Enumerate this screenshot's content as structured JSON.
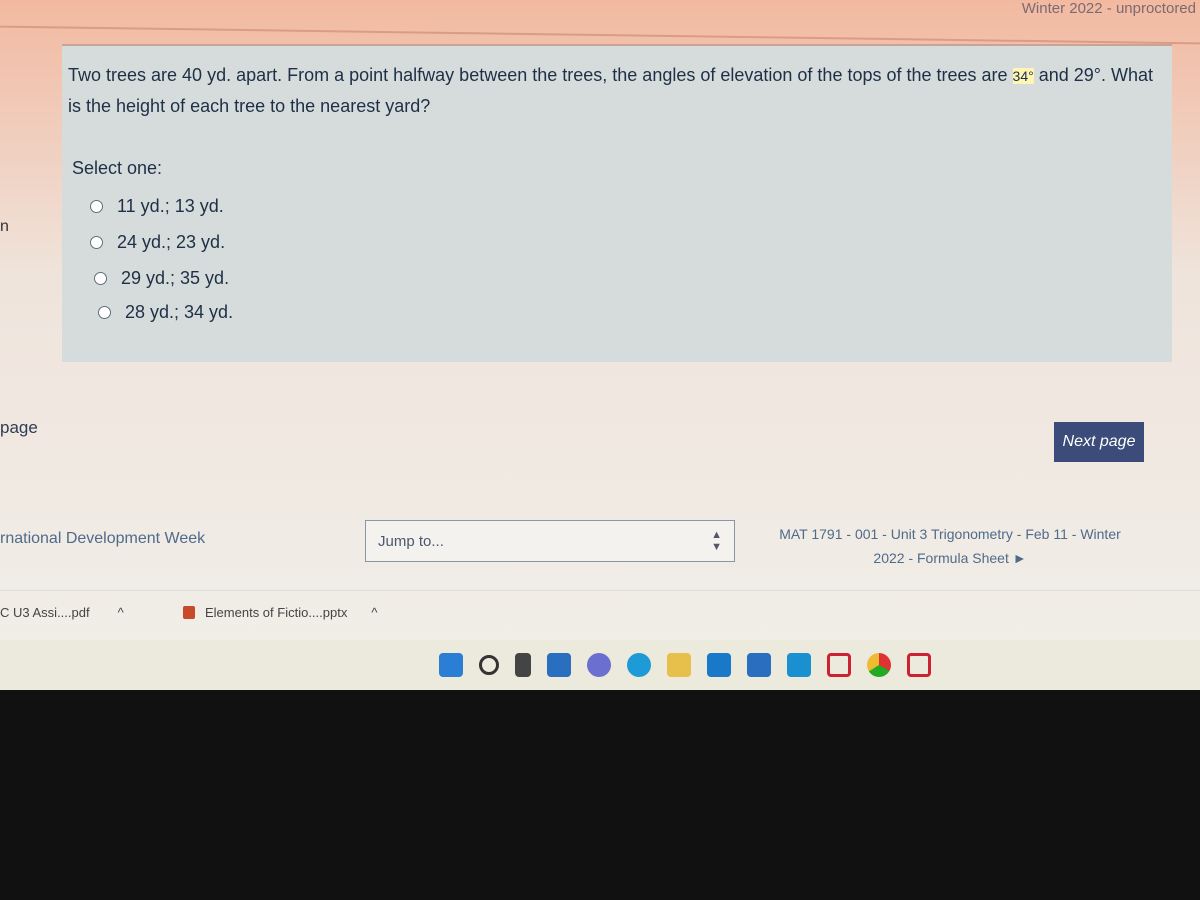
{
  "browser": {
    "title_fragment": "Winter 2022 - unproctored"
  },
  "question": {
    "text_before": "Two trees are 40 yd. apart. From a point halfway between the trees, the angles of elevation of the tops of the trees are ",
    "angle1": "34°",
    "text_after": " and 29°. What is the height of each tree to the nearest yard?",
    "select_label": "Select one:",
    "options": [
      {
        "label": "11 yd.; 13 yd."
      },
      {
        "label": "24 yd.; 23 yd."
      },
      {
        "label": "29 yd.; 35 yd."
      },
      {
        "label": "28 yd.; 34 yd."
      }
    ]
  },
  "nav": {
    "left_edge_1": "n",
    "prev_page": "page",
    "next_page": "Next page"
  },
  "activity_nav": {
    "prev_link": "rnational Development Week",
    "jump_placeholder": "Jump to...",
    "next_link": "MAT 1791 - 001 - Unit 3 Trigonometry - Feb 11 - Winter 2022 - Formula Sheet ►"
  },
  "downloads": [
    {
      "name": "C U3 Assi....pdf"
    },
    {
      "name": "Elements of Fictio....pptx"
    }
  ],
  "taskbar": {
    "icons": [
      "windows-start",
      "search",
      "task-view",
      "widgets",
      "teams-chat",
      "edge",
      "file-explorer",
      "mail",
      "office-l",
      "office-o",
      "mcafee",
      "chrome",
      "mcafee-2"
    ]
  }
}
